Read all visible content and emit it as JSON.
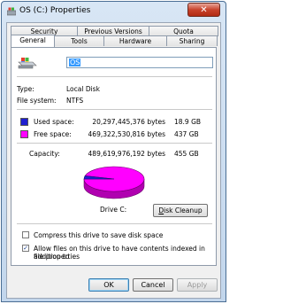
{
  "window": {
    "title": "OS (C:) Properties",
    "close_glyph": "✕"
  },
  "tabs": {
    "row1": [
      "Security",
      "Previous Versions",
      "Quota"
    ],
    "row2": [
      "General",
      "Tools",
      "Hardware",
      "Sharing"
    ],
    "active": "General"
  },
  "general": {
    "drive_name": "OS",
    "type_label": "Type:",
    "type_value": "Local Disk",
    "fs_label": "File system:",
    "fs_value": "NTFS",
    "used": {
      "label": "Used space:",
      "bytes": "20,297,445,376 bytes",
      "gb": "18.9 GB",
      "color": "#1f1fd0"
    },
    "free": {
      "label": "Free space:",
      "bytes": "469,322,530,816 bytes",
      "gb": "437 GB",
      "color": "#ff00ff"
    },
    "capacity": {
      "label": "Capacity:",
      "bytes": "489,619,976,192 bytes",
      "gb": "455 GB"
    },
    "drive_label": "Drive C:",
    "cleanup_label": "Disk Cleanup",
    "used_fraction": 0.0415,
    "compress_label": "Compress this drive to save disk space",
    "compress_checked": false,
    "index_label_line1": "Allow files on this drive to have contents indexed in addition to",
    "index_label_line2": "file properties",
    "index_checked": true
  },
  "buttons": {
    "ok": "OK",
    "cancel": "Cancel",
    "apply": "Apply"
  }
}
